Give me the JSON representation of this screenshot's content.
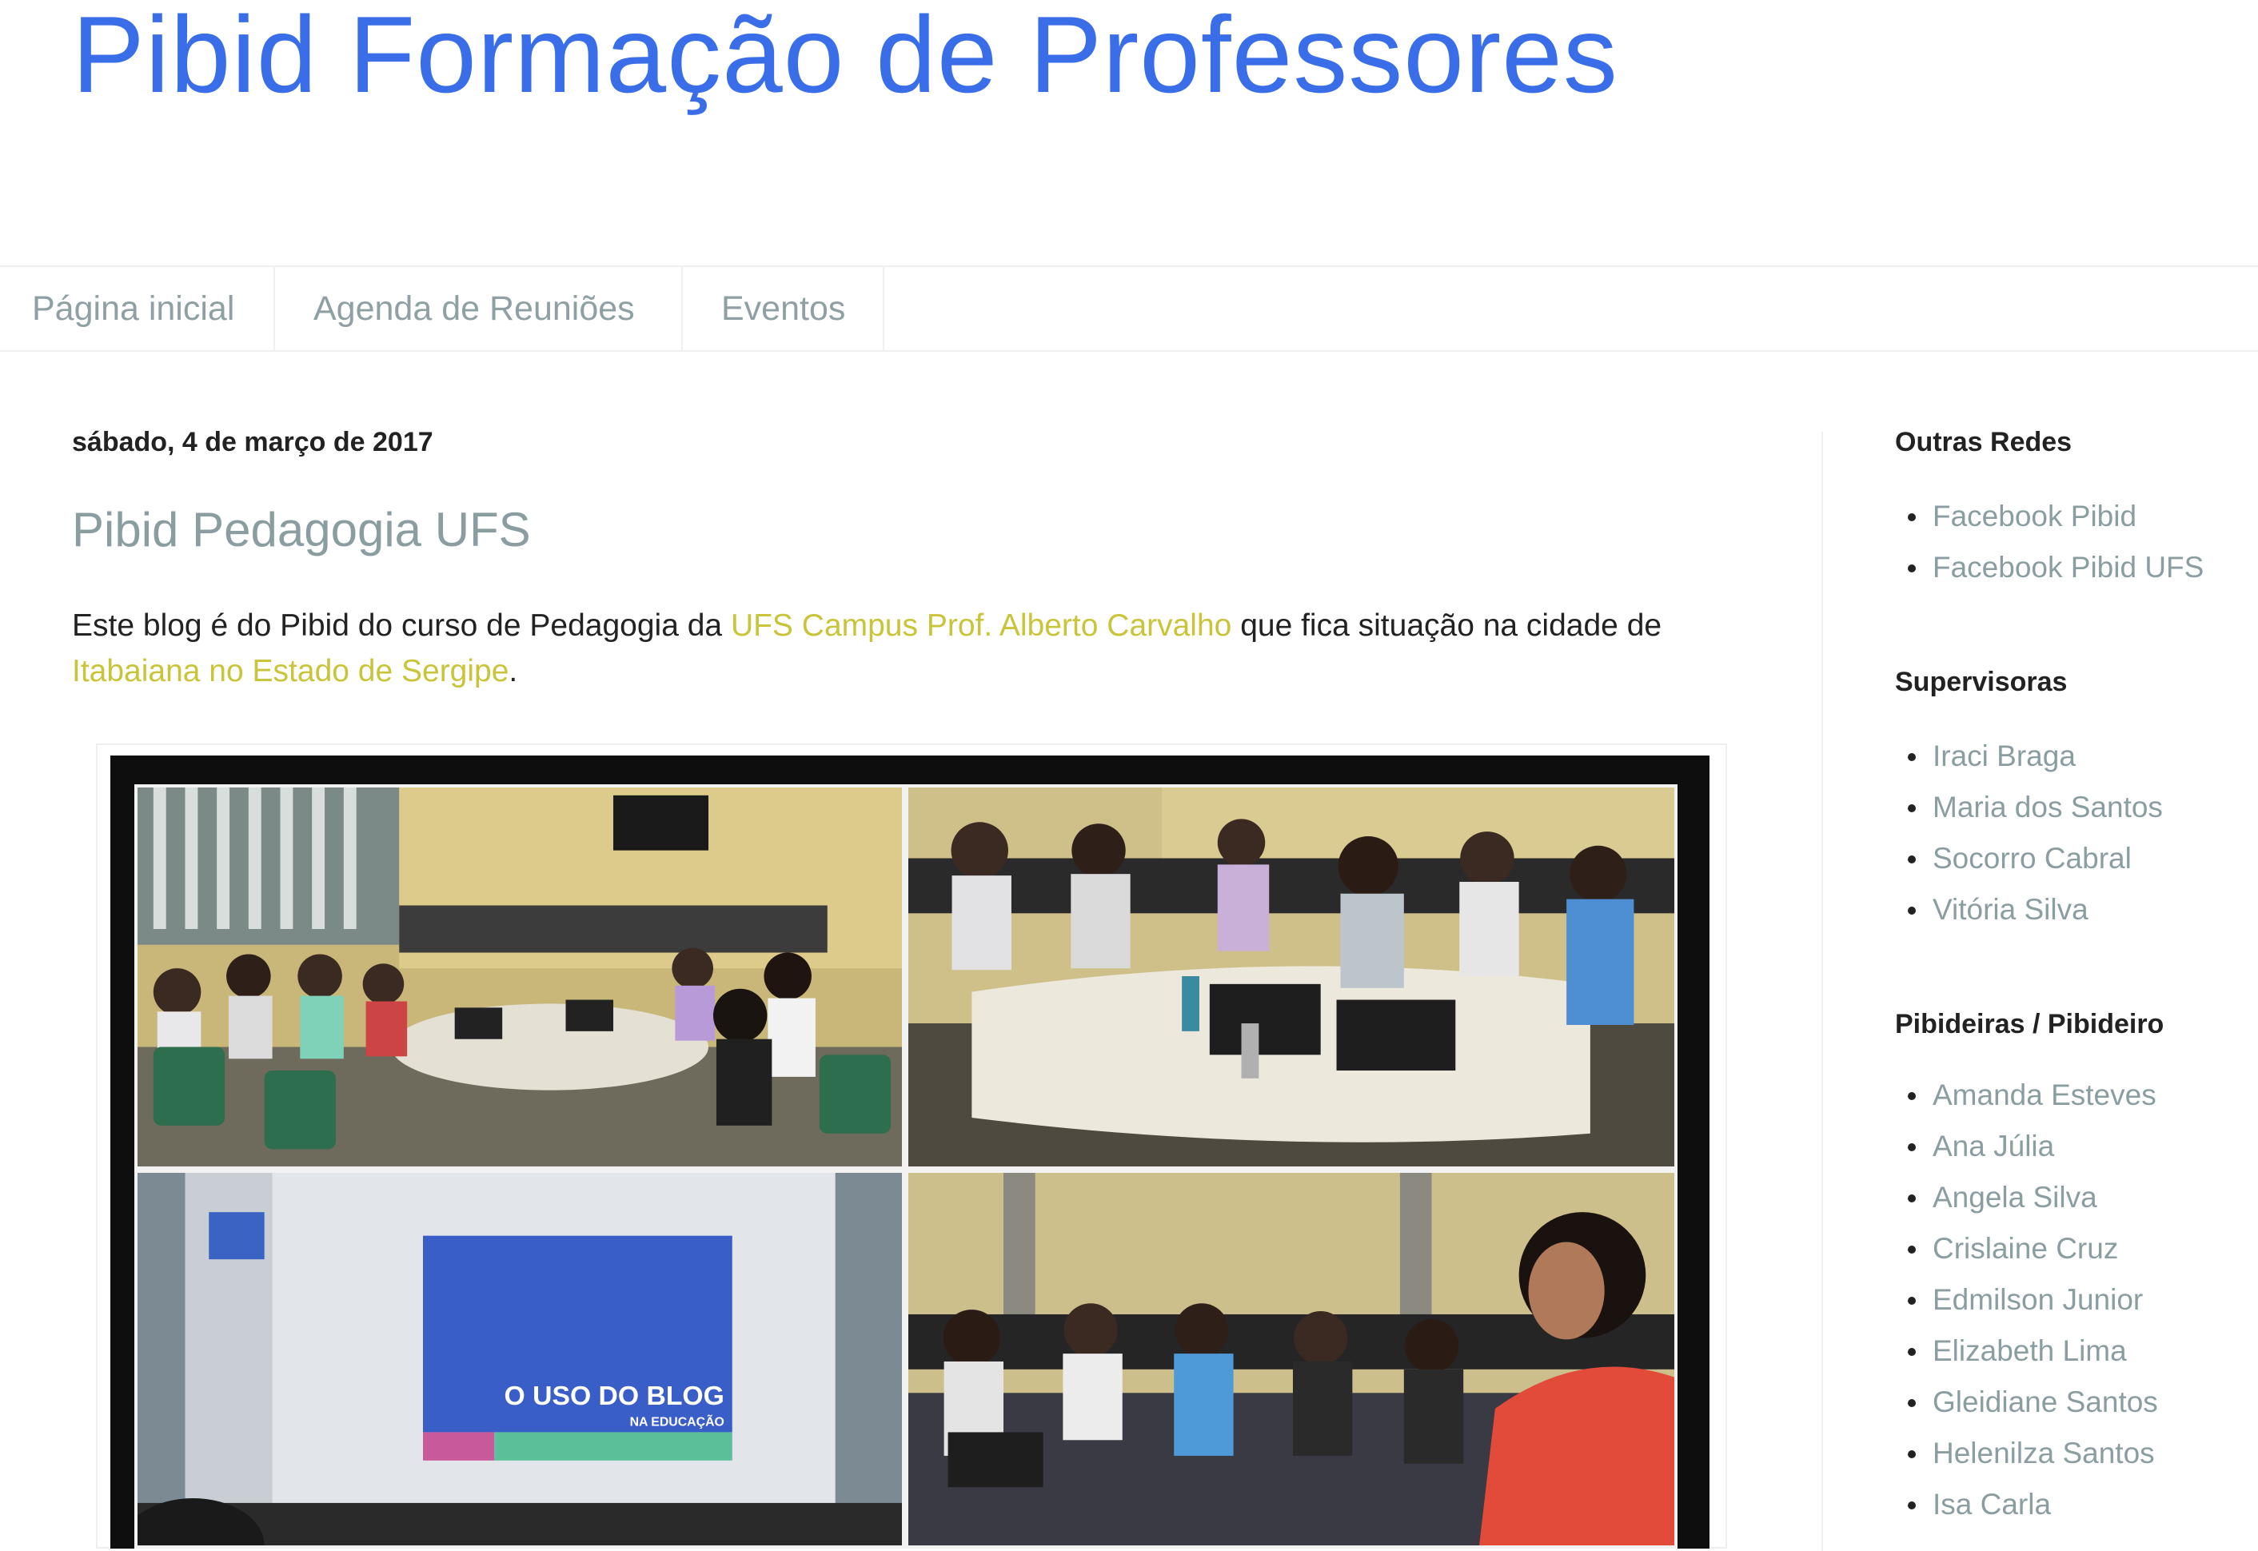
{
  "header": {
    "title": "Pibid Formação de Professores"
  },
  "nav": {
    "tabs": [
      {
        "label": "Página inicial"
      },
      {
        "label": "Agenda de Reuniões"
      },
      {
        "label": "Eventos"
      }
    ]
  },
  "post": {
    "date": "sábado, 4 de março de 2017",
    "title": "Pibid Pedagogia UFS",
    "body_part1": "Este blog é do Pibid do curso de Pedagogia da ",
    "link1": "UFS Campus Prof. Alberto Carvalho",
    "body_part2": " que fica situação na cidade de ",
    "link2": "Itabaiana no Estado de Sergipe",
    "body_part3": ".",
    "image": {
      "slide_title": "O USO DO BLOG",
      "slide_subtitle": "NA EDUCAÇÃO"
    }
  },
  "sidebar": {
    "widgets": [
      {
        "title": "Outras Redes",
        "items": [
          "Facebook Pibid",
          "Facebook Pibid UFS"
        ]
      },
      {
        "title": "Supervisoras",
        "items": [
          "Iraci Braga",
          "Maria dos Santos",
          "Socorro Cabral",
          "Vitória Silva"
        ]
      },
      {
        "title": "Pibideiras / Pibideiro",
        "items": [
          "Amanda Esteves",
          "Ana Júlia",
          "Angela Silva",
          "Crislaine Cruz",
          "Edmilson Junior",
          "Elizabeth Lima",
          "Gleidiane Santos",
          "Helenilza Santos",
          "Isa Carla"
        ]
      }
    ]
  },
  "colors": {
    "title_blue": "#3a6ee8",
    "link_yellow": "#c9c43a",
    "muted_link": "#8a9ea2",
    "nav_text": "#8fa0a4"
  }
}
